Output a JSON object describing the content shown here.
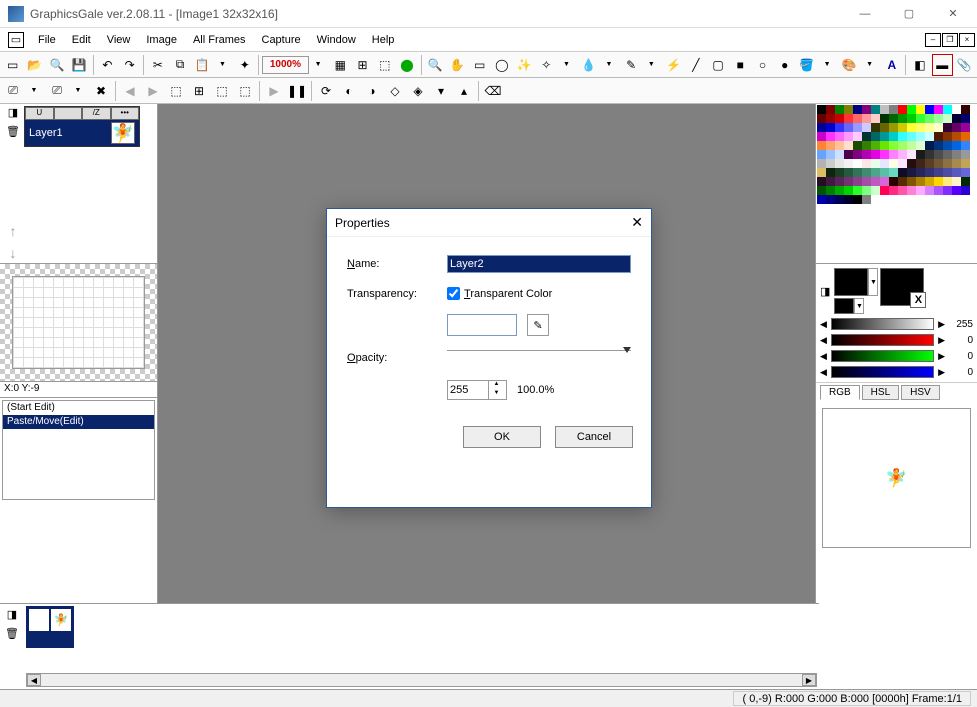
{
  "titlebar": {
    "title": "GraphicsGale ver.2.08.11 - [Image1 32x32x16]"
  },
  "menu": [
    "File",
    "Edit",
    "View",
    "Image",
    "All Frames",
    "Capture",
    "Window",
    "Help"
  ],
  "toolbar2_zoom": "1000%",
  "layer": {
    "name": "Layer1",
    "tabs": [
      "U",
      "",
      "/Z",
      "•••"
    ]
  },
  "coord": "X:0 Y:-9",
  "history": [
    "(Start Edit)",
    "Paste/Move(Edit)"
  ],
  "colormodes": [
    "RGB",
    "HSL",
    "HSV"
  ],
  "color_vals": {
    "gray": "255",
    "r": "0",
    "g": "0",
    "b": "0"
  },
  "status": "( 0,-9)  R:000 G:000 B:000  [0000h]  Frame:1/1",
  "dialog": {
    "title": "Properties",
    "name_label": "Name:",
    "name_value": "Layer2",
    "transp_label": "Transparency:",
    "transp_check": "Transparent Color",
    "opacity_label": "Opacity:",
    "opacity_value": "255",
    "opacity_pct": "100.0%",
    "ok": "OK",
    "cancel": "Cancel"
  },
  "palette_colors": [
    "#000000",
    "#800000",
    "#008000",
    "#808000",
    "#000080",
    "#800080",
    "#008080",
    "#c0c0c0",
    "#808080",
    "#ff0000",
    "#00ff00",
    "#ffff00",
    "#0000ff",
    "#ff00ff",
    "#00ffff",
    "#ffffff",
    "#330000",
    "#660000",
    "#990000",
    "#cc0000",
    "#ff3333",
    "#ff6666",
    "#ff9999",
    "#ffcccc",
    "#003300",
    "#006600",
    "#009900",
    "#00cc00",
    "#33ff33",
    "#66ff66",
    "#99ff99",
    "#ccffcc",
    "#000033",
    "#000066",
    "#000099",
    "#0000cc",
    "#3333ff",
    "#6666ff",
    "#9999ff",
    "#ccccff",
    "#333300",
    "#666600",
    "#999900",
    "#cccc00",
    "#ffff33",
    "#ffff66",
    "#ffff99",
    "#ffffcc",
    "#330033",
    "#660066",
    "#990099",
    "#cc00cc",
    "#ff33ff",
    "#ff66ff",
    "#ff99ff",
    "#ffccff",
    "#003333",
    "#006666",
    "#009999",
    "#00cccc",
    "#33ffff",
    "#66ffff",
    "#99ffff",
    "#ccffff",
    "#4d1a00",
    "#803300",
    "#b34d00",
    "#e66600",
    "#ff8533",
    "#ffa366",
    "#ffc299",
    "#ffe0cc",
    "#1a4d00",
    "#338000",
    "#4db300",
    "#66e600",
    "#85ff33",
    "#a3ff66",
    "#c2ff99",
    "#e0ffcc",
    "#001a4d",
    "#003380",
    "#004db3",
    "#0066e6",
    "#3385ff",
    "#66a3ff",
    "#99c2ff",
    "#cce0ff",
    "#4d004d",
    "#800080",
    "#b300b3",
    "#e600e6",
    "#ff33ff",
    "#ff80ff",
    "#ffb3ff",
    "#ffe6ff",
    "#1a1a1a",
    "#333333",
    "#4d4d4d",
    "#666666",
    "#808080",
    "#999999",
    "#b3b3b3",
    "#cccccc",
    "#e6e6e6",
    "#f2f2f2",
    "#ffffff",
    "#ffe6e6",
    "#e6ffe6",
    "#e6e6ff",
    "#fffde6",
    "#ffe6ff",
    "#260d0d",
    "#40261a",
    "#593f26",
    "#735933",
    "#8c7240",
    "#a68b4d",
    "#bfa559",
    "#d9be66",
    "#0d260d",
    "#1a4026",
    "#26593f",
    "#337359",
    "#408c72",
    "#4da68b",
    "#59bfa5",
    "#66d9be",
    "#0d0d26",
    "#1a1a40",
    "#262659",
    "#333373",
    "#40408c",
    "#4d4da6",
    "#5959bf",
    "#6666d9",
    "#260d26",
    "#401a40",
    "#592659",
    "#733373",
    "#8c408c",
    "#a64da6",
    "#bf59bf",
    "#d966d9",
    "#2b0000",
    "#552b00",
    "#805500",
    "#aa8000",
    "#d4aa00",
    "#ffd500",
    "#ffea80",
    "#fff5cc",
    "#002b00",
    "#005500",
    "#008000",
    "#00aa00",
    "#00d400",
    "#2bff2b",
    "#80ff80",
    "#ccffcc",
    "#ff0055",
    "#ff2b80",
    "#ff55aa",
    "#ff80d5",
    "#ffaaff",
    "#d580ff",
    "#aa55ff",
    "#802bff",
    "#5500ff",
    "#2b00d5",
    "#0000aa",
    "#000080",
    "#000055",
    "#00002b",
    "#000000",
    "#808080"
  ]
}
